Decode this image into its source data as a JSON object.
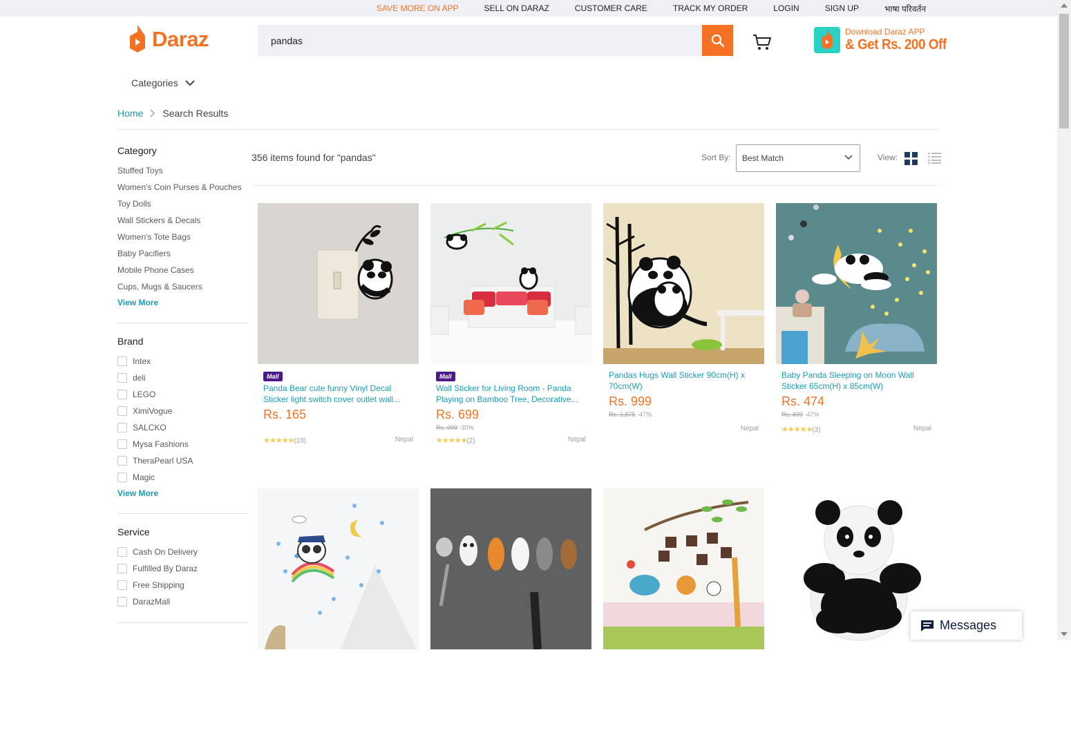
{
  "topbar": {
    "links": [
      "SAVE MORE ON APP",
      "SELL ON DARAZ",
      "CUSTOMER CARE",
      "TRACK MY ORDER",
      "LOGIN",
      "SIGN UP",
      "भाषा परिवर्तन"
    ]
  },
  "header": {
    "logo_text": "Daraz",
    "search_value": "pandas",
    "app_ad_line1": "Download Daraz APP",
    "app_ad_line2": "& Get Rs. 200 Off"
  },
  "categories_label": "Categories",
  "breadcrumb": {
    "home": "Home",
    "current": "Search Results"
  },
  "results": {
    "count_text": "356 items found for \"pandas\"",
    "sort_label": "Sort By:",
    "sort_value": "Best Match",
    "view_label": "View:"
  },
  "sidebar": {
    "category": {
      "title": "Category",
      "items": [
        "Stuffed Toys",
        "Women's Coin Purses & Pouches",
        "Toy Dolls",
        "Wall Stickers & Decals",
        "Women's Tote Bags",
        "Baby Pacifiers",
        "Mobile Phone Cases",
        "Cups, Mugs & Saucers"
      ],
      "more": "View More"
    },
    "brand": {
      "title": "Brand",
      "items": [
        "Intex",
        "deli",
        "LEGO",
        "XimiVogue",
        "SALCKO",
        "Mysa Fashions",
        "TheraPearl USA",
        "Magic"
      ],
      "more": "View More"
    },
    "service": {
      "title": "Service",
      "items": [
        "Cash On Delivery",
        "Fulfilled By Daraz",
        "Free Shipping",
        "DarazMall"
      ]
    }
  },
  "products": [
    {
      "mall": "Mall",
      "title": "Panda Bear cute funny Vinyl Decal Sticker light switch cover outlet wall...",
      "price": "Rs. 165",
      "orig": "",
      "discount": "",
      "stars": "★★★★★",
      "reviews": "(10)",
      "location": "Nepal"
    },
    {
      "mall": "Mall",
      "title": "Wall Sticker for Living Room - Panda Playing on Bamboo Tree, Decorative...",
      "price": "Rs. 699",
      "orig": "Rs. 999",
      "discount": "-30%",
      "stars": "★★★★★",
      "reviews": "(2)",
      "location": "Nepal"
    },
    {
      "mall": "",
      "title": "Pandas Hugs Wall Sticker 90cm(H) x 70cm(W)",
      "price": "Rs. 999",
      "orig": "Rs. 1,875",
      "discount": "-47%",
      "stars": "",
      "reviews": "",
      "location": "Nepal"
    },
    {
      "mall": "",
      "title": "Baby Panda Sleeping on Moon Wall Sticker 65cm(H) x 85cm(W)",
      "price": "Rs. 474",
      "orig": "Rs. 899",
      "discount": "-47%",
      "stars": "★★★★★",
      "reviews": "(3)",
      "location": "Nepal"
    }
  ],
  "messages_label": "Messages",
  "colors": {
    "accent": "#f57224",
    "link": "#1a9cb7",
    "mall": "#4a1a8a"
  }
}
